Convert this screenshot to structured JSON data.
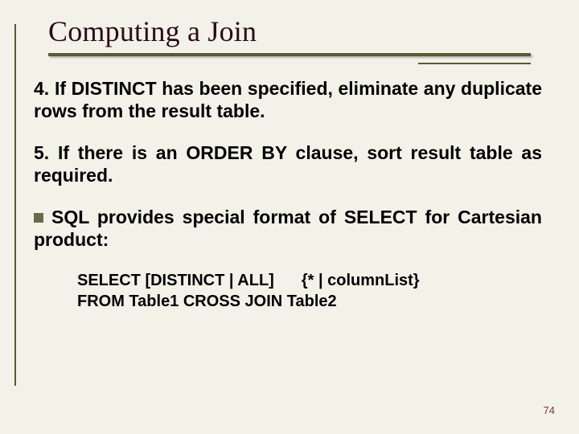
{
  "title": "Computing a Join",
  "items": {
    "four": {
      "marker": "4.",
      "text": "If DISTINCT has been specified, eliminate any duplicate rows from the result table."
    },
    "five": {
      "marker": "5.",
      "text": "If there is an ORDER BY clause, sort result table as required."
    },
    "bullet": {
      "text": "SQL provides special format of SELECT for Cartesian product:"
    }
  },
  "code": {
    "line1a": "SELECT   [DISTINCT | ALL]",
    "line1b": "{* | columnList}",
    "line2": "FROM Table1 CROSS JOIN Table2"
  },
  "page_number": "74"
}
